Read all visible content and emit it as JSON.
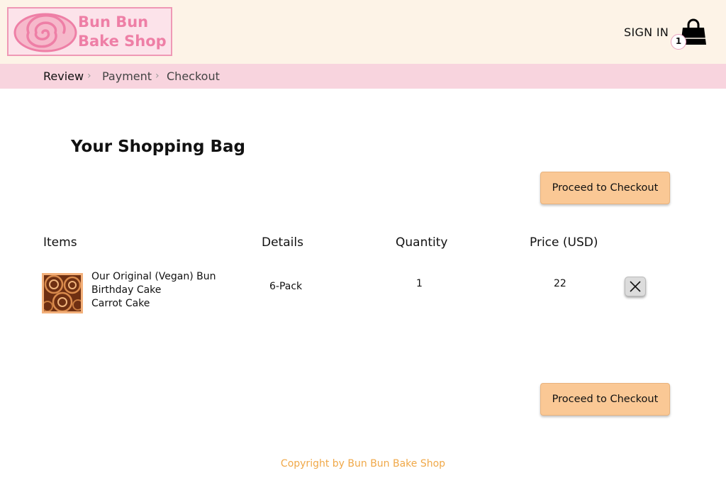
{
  "header": {
    "logo_line1": "Bun Bun",
    "logo_line2": "Bake Shop",
    "signin_label": "SIGN IN",
    "cart_count": "1",
    "cart_icon": "shopping-bag-icon"
  },
  "breadcrumb": {
    "items": [
      "Review",
      "Payment",
      "Checkout"
    ],
    "active": "Review"
  },
  "page": {
    "title": "Your Shopping Bag",
    "checkout_label": "Proceed to Checkout"
  },
  "table": {
    "headers": [
      "Items",
      "Details",
      "Quantity",
      "Price (USD)"
    ],
    "rows": [
      {
        "name_lines": [
          "Our Original (Vegan) Bun",
          "Birthday Cake",
          "Carrot Cake"
        ],
        "details": "6-Pack",
        "quantity": "1",
        "price": "22",
        "remove_icon": "close-icon"
      }
    ]
  },
  "footer": {
    "copyright": "Copyright by Bun Bun Bake Shop"
  },
  "colors": {
    "header_bg": "#fdf3e7",
    "breadcrumb_bg": "#f8d4de",
    "logo_pink": "#ee7fa6",
    "button_bg": "#fac895",
    "footer_text": "#f0a848"
  }
}
